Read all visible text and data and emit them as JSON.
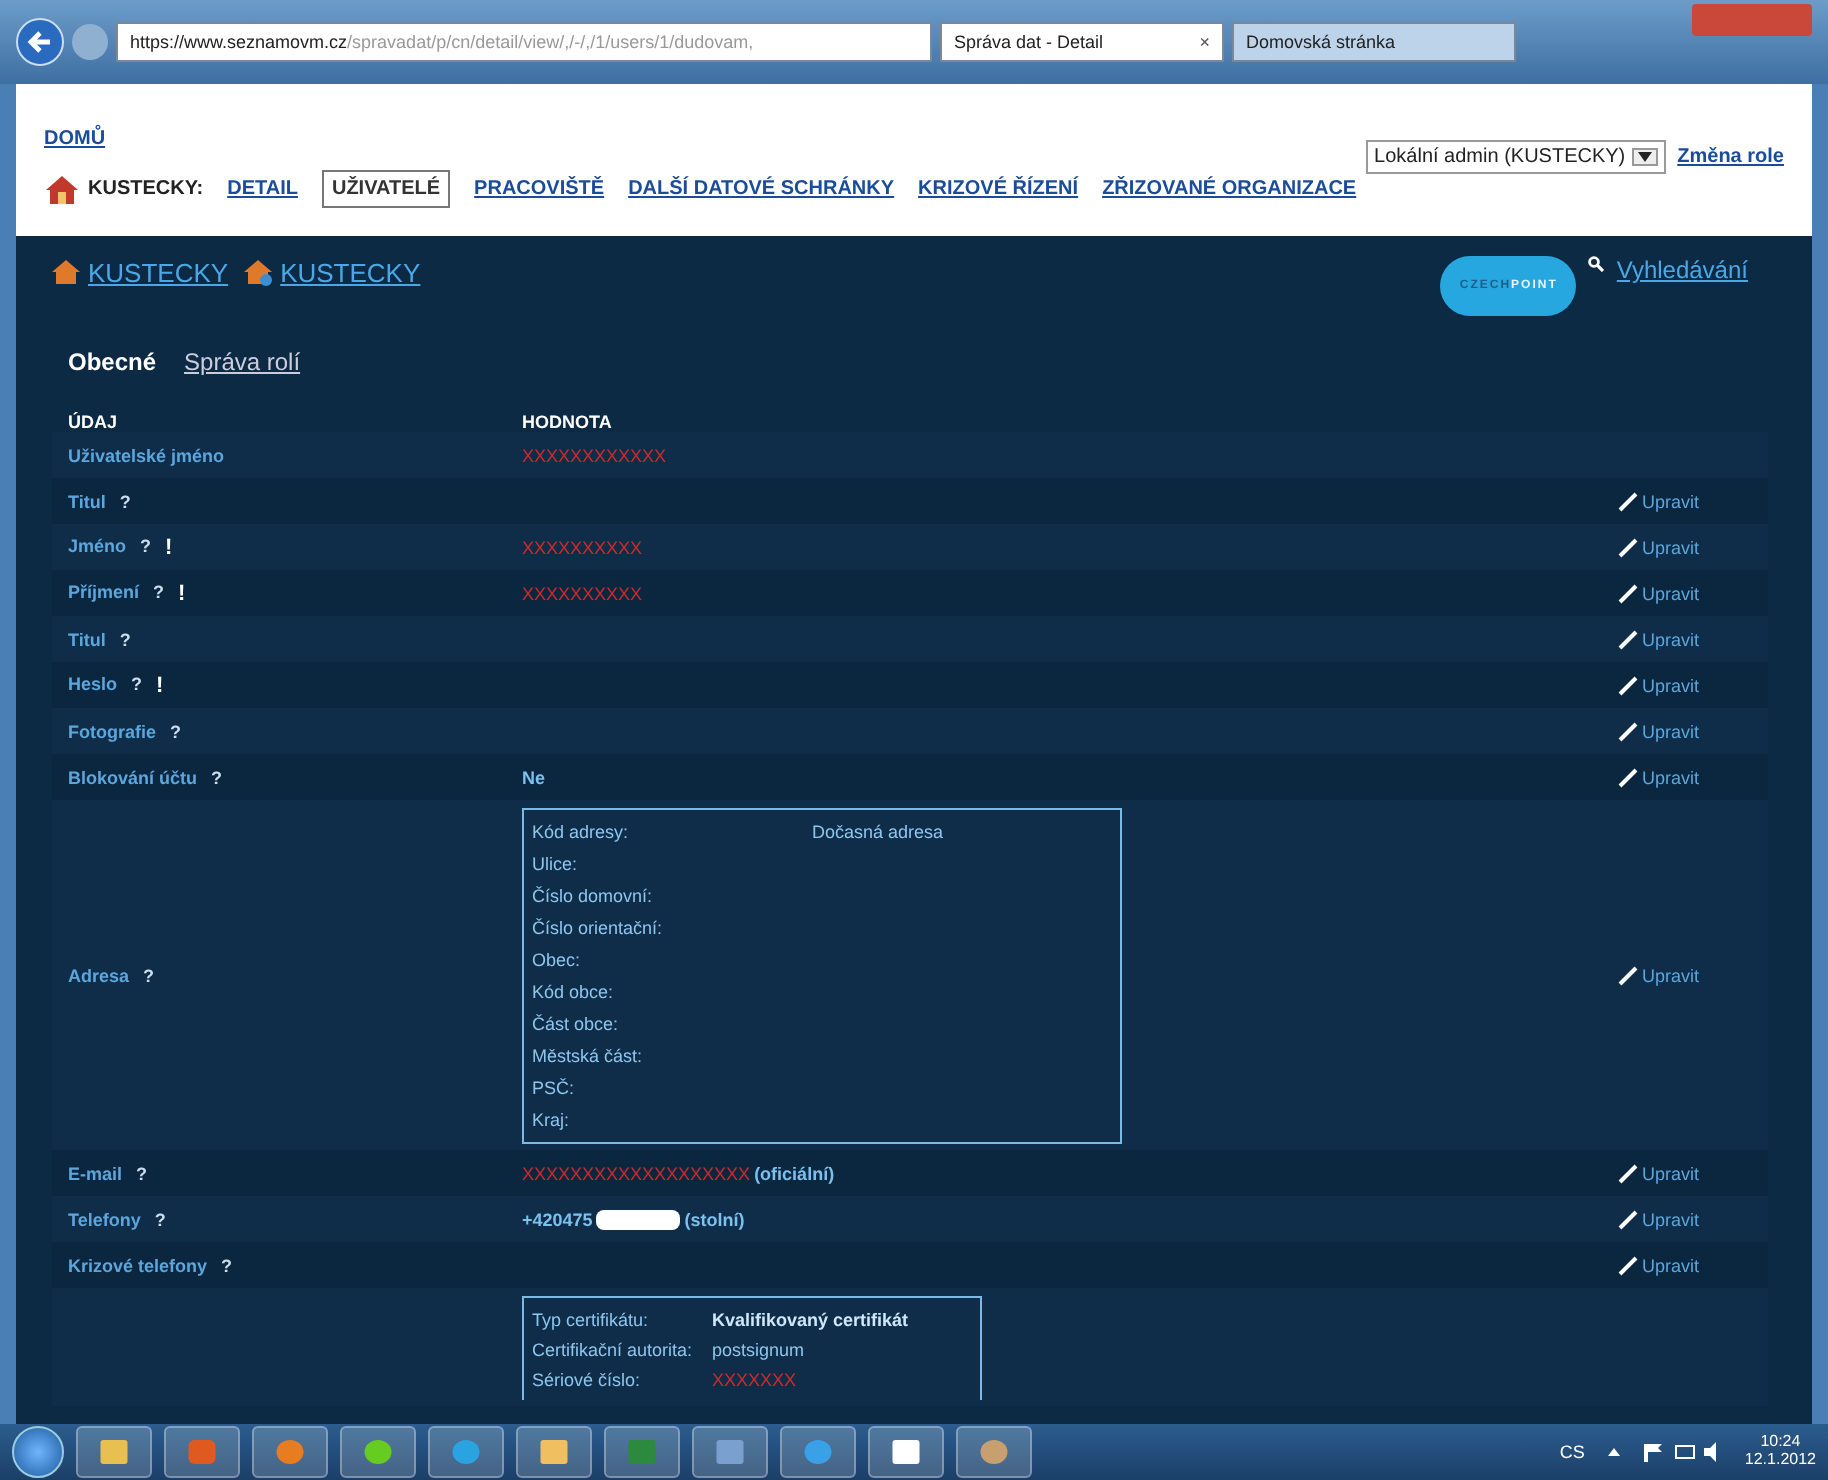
{
  "browser": {
    "url_host": "https://www.seznamovm.cz",
    "url_path": "/spravadat/p/cn/detail/view/,/-/,/1/users/1/dudovam,",
    "tabs": [
      {
        "title": "Správa dat - Detail",
        "selected": true,
        "close": "×"
      },
      {
        "title": "Domovská stránka",
        "selected": false
      }
    ]
  },
  "header": {
    "home_link": "DOMŮ",
    "org_label": "KUSTECKY:",
    "nav": [
      {
        "label": "DETAIL",
        "selected": false
      },
      {
        "label": "UŽIVATELÉ",
        "selected": true
      },
      {
        "label": "PRACOVIŠTĚ",
        "selected": false
      },
      {
        "label": "DALŠÍ DATOVÉ SCHRÁNKY",
        "selected": false
      },
      {
        "label": "KRIZOVÉ ŘÍZENÍ",
        "selected": false
      },
      {
        "label": "ZŘIZOVANÉ ORGANIZACE",
        "selected": false
      }
    ],
    "role_select": "Lokální admin (KUSTECKY)",
    "role_link": "Změna role"
  },
  "breadcrumb": [
    "KUSTECKY",
    "KUSTECKY"
  ],
  "logo": {
    "part_1": "CZECH",
    "part_2": "POINT"
  },
  "search_link": "Vyhledávání",
  "subtabs": [
    {
      "label": "Obecné",
      "selected": true
    },
    {
      "label": "Správa rolí",
      "selected": false
    }
  ],
  "table": {
    "columns": [
      "ÚDAJ",
      "HODNOTA"
    ],
    "rows": [
      {
        "kind": "field",
        "label": "Uživatelské jméno",
        "marks": [],
        "value": [
          {
            "kind": "masked",
            "text": "XXXXXXXXXXXX"
          }
        ]
      },
      {
        "kind": "field",
        "label": "Titul",
        "marks": [
          "?"
        ],
        "value": [],
        "edit": "Upravit"
      },
      {
        "kind": "field",
        "label": "Jméno",
        "marks": [
          "?",
          "!"
        ],
        "value": [
          {
            "kind": "masked",
            "text": "XXXXXXXXXX"
          }
        ],
        "edit": "Upravit"
      },
      {
        "kind": "field",
        "label": "Příjmení",
        "marks": [
          "?",
          "!"
        ],
        "value": [
          {
            "kind": "masked",
            "text": "XXXXXXXXXX"
          }
        ],
        "edit": "Upravit"
      },
      {
        "kind": "field",
        "label": "Titul",
        "marks": [
          "?"
        ],
        "value": [],
        "edit": "Upravit"
      },
      {
        "kind": "field",
        "label": "Heslo",
        "marks": [
          "?",
          "!"
        ],
        "value": [],
        "edit": "Upravit"
      },
      {
        "kind": "field",
        "label": "Fotografie",
        "marks": [
          "?"
        ],
        "value": [],
        "edit": "Upravit"
      },
      {
        "kind": "field",
        "label": "Blokování účtu",
        "marks": [
          "?"
        ],
        "value": [
          {
            "kind": "text",
            "text": "Ne"
          }
        ],
        "edit": "Upravit"
      },
      {
        "kind": "block",
        "label": "Adresa",
        "marks": [
          "?"
        ],
        "edit": "Upravit",
        "block": [
          {
            "label": "Kód adresy:",
            "value": "Dočasná adresa"
          },
          {
            "label": "Ulice:"
          },
          {
            "label": "Číslo domovní:"
          },
          {
            "label": "Číslo orientační:"
          },
          {
            "label": "Obec:"
          },
          {
            "label": "Kód obce:"
          },
          {
            "label": "Část obce:"
          },
          {
            "label": "Městská část:"
          },
          {
            "label": "PSČ:"
          },
          {
            "label": "Kraj:"
          }
        ]
      },
      {
        "kind": "field",
        "label": "E-mail",
        "marks": [
          "?"
        ],
        "value": [
          {
            "kind": "masked",
            "text": "XXXXXXXXXXXXXXXXXXX"
          },
          {
            "kind": "text",
            "text": "(oficiální)"
          }
        ],
        "edit": "Upravit"
      },
      {
        "kind": "field",
        "label": "Telefony",
        "marks": [
          "?"
        ],
        "value": [
          {
            "kind": "text",
            "text": "+420475"
          },
          {
            "kind": "blot"
          },
          {
            "kind": "text",
            "text": "(stolní)"
          }
        ],
        "edit": "Upravit"
      },
      {
        "kind": "field",
        "label": "Krizové telefony",
        "marks": [
          "?"
        ],
        "value": [],
        "edit": "Upravit"
      },
      {
        "kind": "block",
        "label": "",
        "marks": [],
        "block": [
          {
            "label": "Typ certifikátu:",
            "value": "Kvalifikovaný certifikát"
          },
          {
            "label": "Certifikační autorita:",
            "value": "postsignum"
          },
          {
            "label": "Sériové číslo:",
            "value": "XXXXXXX",
            "masked": true
          }
        ]
      }
    ]
  },
  "taskbar": {
    "language": "CS",
    "time": "10:24",
    "date": "12.1.2012"
  }
}
